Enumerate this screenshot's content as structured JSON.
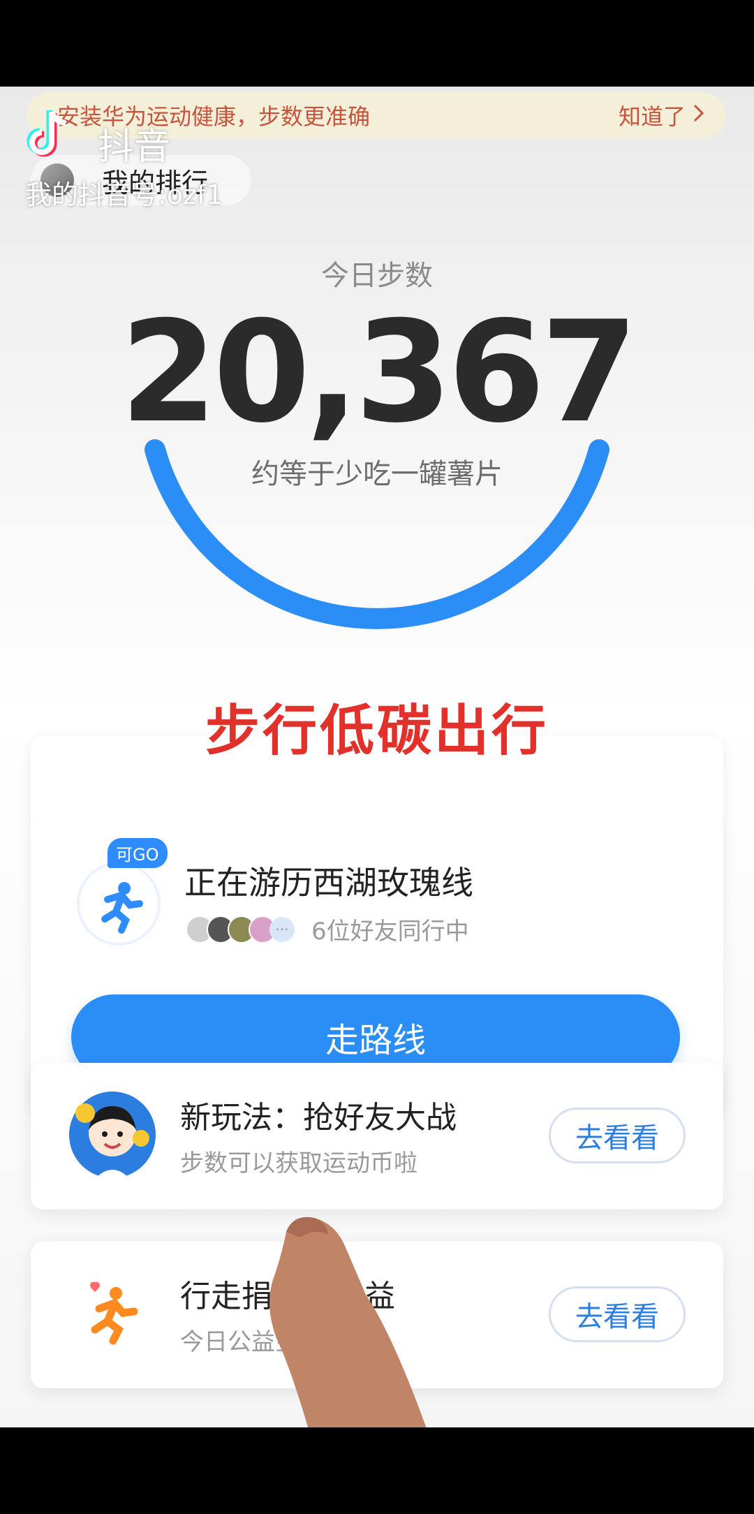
{
  "banner": {
    "text": "安装华为运动健康，步数更准确",
    "action": "知道了"
  },
  "watermark": {
    "app": "抖音",
    "account": "我的抖音号:ozf1"
  },
  "ranking": {
    "label": "我的排行"
  },
  "steps": {
    "label": "今日步数",
    "value": "20,367",
    "equivalent": "约等于少吃一罐薯片"
  },
  "overlay": {
    "caption": "步行低碳出行"
  },
  "route": {
    "badge": "可GO",
    "title": "正在游历西湖玫瑰线",
    "friends_text": "6位好友同行中",
    "friends_more": "···",
    "button": "走路线"
  },
  "activities": [
    {
      "title": "新玩法：抢好友大战",
      "subtitle": "步数可以获取运动币啦",
      "button": "去看看"
    },
    {
      "title": "行走捐步数公益",
      "subtitle": "今日公益金已领取",
      "button": "去看看"
    }
  ],
  "colors": {
    "accent": "#2b8ef6",
    "banner_bg": "#f3efd9",
    "banner_text": "#c9543e",
    "caption": "#e2302b"
  }
}
